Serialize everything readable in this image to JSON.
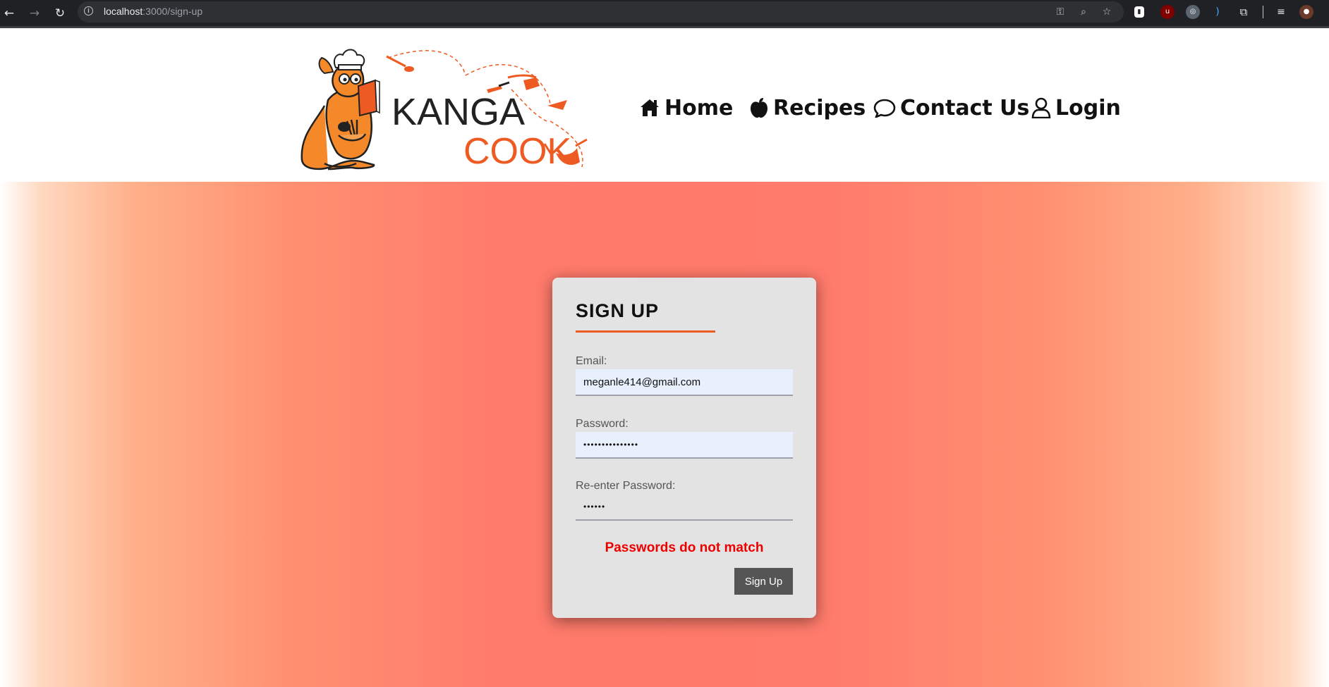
{
  "browser": {
    "url_host": "localhost",
    "url_path": ":3000/sign-up"
  },
  "site": {
    "logo": {
      "line1": "KANGA",
      "line2": "COOK"
    },
    "nav": [
      {
        "label": "Home",
        "icon": "home-icon"
      },
      {
        "label": "Recipes",
        "icon": "apple-icon"
      },
      {
        "label": "Contact Us",
        "icon": "chat-bubble-icon"
      },
      {
        "label": "Login",
        "icon": "user-icon"
      }
    ]
  },
  "form": {
    "title": "SIGN UP",
    "email_label": "Email:",
    "email_value": "meganle414@gmail.com",
    "password_label": "Password:",
    "password_value": "•••••••••••••••",
    "reenter_label": "Re-enter Password:",
    "reenter_value": "••••••",
    "error": "Passwords do not match",
    "submit_label": "Sign Up"
  },
  "colors": {
    "accent": "#ee5b22",
    "error": "#ee0000",
    "button": "#555555",
    "card": "#e3e3e3"
  }
}
